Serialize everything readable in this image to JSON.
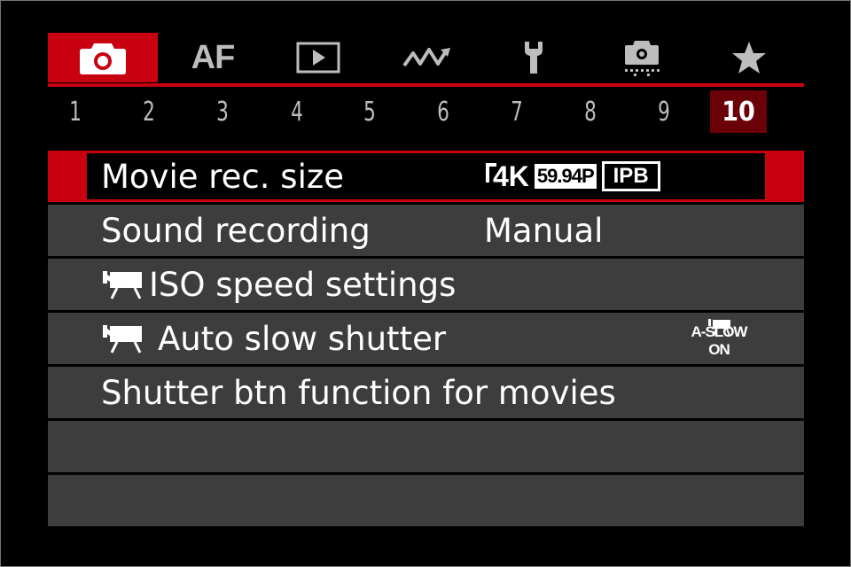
{
  "tabs": [
    {
      "name": "shooting",
      "icon": "camera-icon",
      "active": true
    },
    {
      "name": "af",
      "label": "AF"
    },
    {
      "name": "playback",
      "icon": "playback-icon"
    },
    {
      "name": "wireless",
      "icon": "wireless-icon"
    },
    {
      "name": "setup",
      "icon": "wrench-icon"
    },
    {
      "name": "custom-functions",
      "icon": "custom-camera-icon"
    },
    {
      "name": "my-menu",
      "icon": "star-icon"
    }
  ],
  "pages": [
    "1",
    "2",
    "3",
    "4",
    "5",
    "6",
    "7",
    "8",
    "9",
    "10"
  ],
  "active_page": "10",
  "menu": {
    "items": [
      {
        "label": "Movie rec. size",
        "value": {
          "resolution": "4K",
          "frame_rate": "59.94P",
          "compression": "IPB"
        }
      },
      {
        "label": "Sound recording",
        "value": "Manual"
      },
      {
        "label": "ISO speed settings",
        "icon": "movie-camera-icon"
      },
      {
        "label": "Auto slow shutter",
        "icon": "movie-camera-icon",
        "value": "A-SLOW ON"
      },
      {
        "label": "Shutter btn function for movies"
      }
    ]
  },
  "colors": {
    "accent": "#c8000f",
    "active_page_bg": "#6a0008",
    "row_bg": "#3d3d3d",
    "inactive_text": "#bdbdbd"
  }
}
